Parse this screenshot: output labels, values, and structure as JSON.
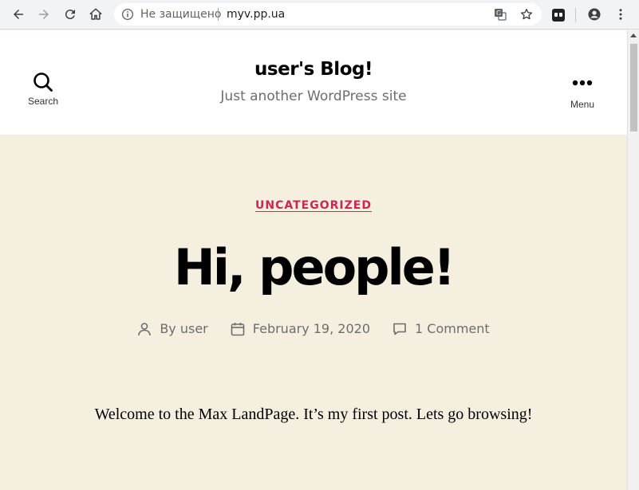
{
  "browser": {
    "security_label": "Не защищено",
    "url": "myv.pp.ua",
    "icons": [
      "back-icon",
      "forward-icon",
      "reload-icon",
      "home-icon",
      "info-icon",
      "translate-icon",
      "star-icon",
      "extension-icon",
      "account-icon",
      "more-vert-icon"
    ]
  },
  "header": {
    "search_label": "Search",
    "menu_label": "Menu",
    "site_title": "user's Blog!",
    "site_description": "Just another WordPress site"
  },
  "post": {
    "category": "UNCATEGORIZED",
    "title": "Hi, people!",
    "author": "By user",
    "date": "February 19, 2020",
    "comments": "1 Comment",
    "body": "Welcome to the Max LandPage. It’s my first post. Lets go browsing!"
  },
  "colors": {
    "accent": "#cd2653",
    "background": "#f5efe0",
    "header_bg": "#ffffff",
    "muted_text": "#6d6d6d"
  }
}
